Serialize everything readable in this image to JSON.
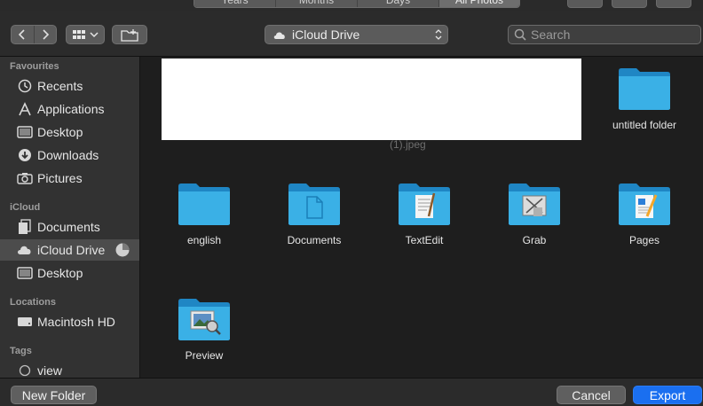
{
  "top_segments": [
    "Years",
    "Months",
    "Days",
    "All Photos"
  ],
  "toolbar": {
    "location": "iCloud Drive",
    "search_placeholder": "Search"
  },
  "sidebar": {
    "favourites_title": "Favourites",
    "favourites": [
      {
        "label": "Recents",
        "icon": "clock-icon"
      },
      {
        "label": "Applications",
        "icon": "applications-icon"
      },
      {
        "label": "Desktop",
        "icon": "desktop-icon"
      },
      {
        "label": "Downloads",
        "icon": "download-icon"
      },
      {
        "label": "Pictures",
        "icon": "camera-icon"
      }
    ],
    "icloud_title": "iCloud",
    "icloud": [
      {
        "label": "Documents",
        "icon": "documents-icon"
      },
      {
        "label": "iCloud Drive",
        "icon": "cloud-icon",
        "selected": true
      },
      {
        "label": "Desktop",
        "icon": "desktop-icon"
      }
    ],
    "locations_title": "Locations",
    "locations": [
      {
        "label": "Macintosh HD",
        "icon": "hard-drive-icon"
      }
    ],
    "tags_title": "Tags",
    "tags": [
      {
        "label": "view",
        "icon": "tag-circle-icon"
      }
    ]
  },
  "content": {
    "faded_file_name": "(1).jpeg",
    "items": [
      {
        "label": "untitled folder",
        "icon": "folder-icon"
      },
      {
        "label": "english",
        "icon": "folder-icon"
      },
      {
        "label": "Documents",
        "icon": "documents-folder-icon"
      },
      {
        "label": "TextEdit",
        "icon": "textedit-folder-icon"
      },
      {
        "label": "Grab",
        "icon": "grab-folder-icon"
      },
      {
        "label": "Pages",
        "icon": "pages-folder-icon"
      },
      {
        "label": "Preview",
        "icon": "preview-folder-icon"
      }
    ]
  },
  "footer": {
    "new_folder": "New Folder",
    "cancel": "Cancel",
    "export": "Export"
  },
  "colors": {
    "accent": "#1a6ff0",
    "folder": "#2fa7e0",
    "sidebar_bg": "#323232",
    "content_bg": "#1e1e1e"
  }
}
